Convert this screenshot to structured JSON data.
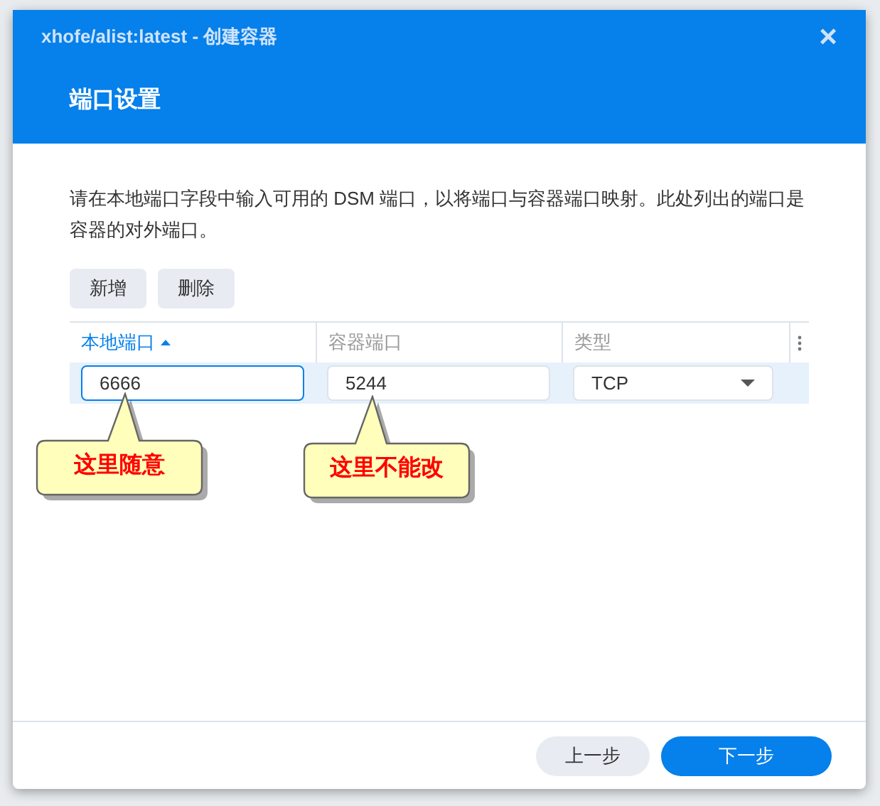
{
  "window": {
    "title": "xhofe/alist:latest - 创建容器",
    "close": "×"
  },
  "header": {
    "title": "端口设置"
  },
  "description": "请在本地端口字段中输入可用的 DSM 端口，以将端口与容器端口映射。此处列出的端口是容器的对外端口。",
  "toolbar": [
    "新增",
    "删除"
  ],
  "table": {
    "columns": [
      {
        "label": "本地端口",
        "sorted": true
      },
      {
        "label": "容器端口",
        "sorted": false
      },
      {
        "label": "类型",
        "sorted": false
      }
    ],
    "rows": [
      {
        "selected": true,
        "local_port": "6666",
        "container_port": "5244",
        "type": "TCP"
      }
    ]
  },
  "callouts": [
    {
      "text": "这里随意"
    },
    {
      "text": "这里不能改"
    }
  ],
  "footer": {
    "buttons": [
      {
        "label": "上一步",
        "kind": "secondary"
      },
      {
        "label": "下一步",
        "kind": "primary"
      }
    ]
  }
}
